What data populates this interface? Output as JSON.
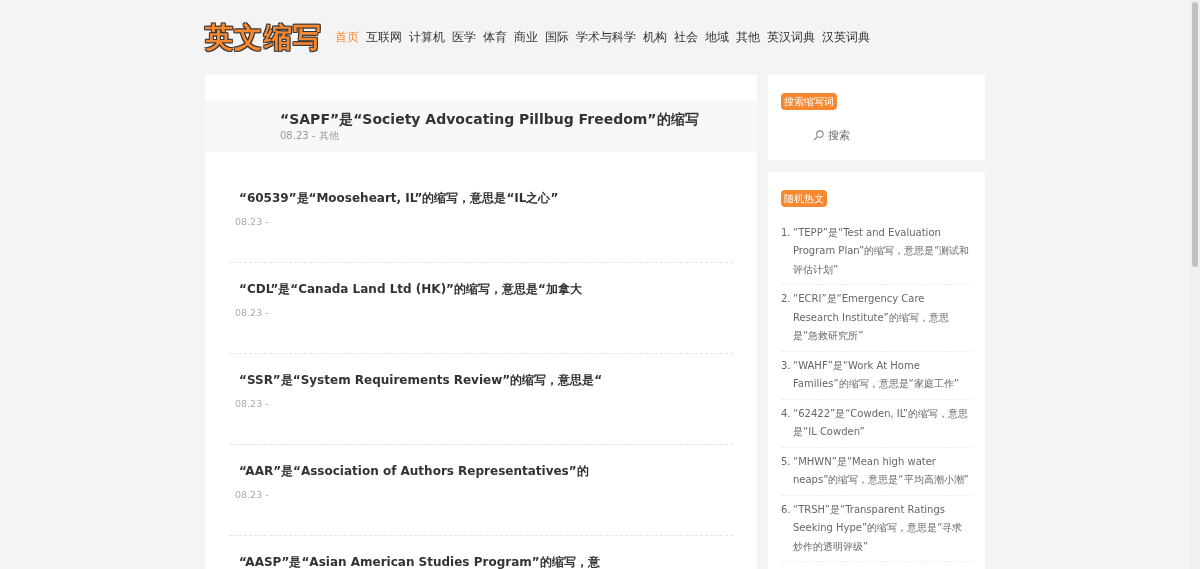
{
  "logo": "英文缩写",
  "nav": [
    {
      "label": "首页",
      "selected": true
    },
    {
      "label": "互联网",
      "selected": false
    },
    {
      "label": "计算机",
      "selected": false
    },
    {
      "label": "医学",
      "selected": false
    },
    {
      "label": "体育",
      "selected": false
    },
    {
      "label": "商业",
      "selected": false
    },
    {
      "label": "国际",
      "selected": false
    },
    {
      "label": "学术与科学",
      "selected": false
    },
    {
      "label": "机构",
      "selected": false
    },
    {
      "label": "社会",
      "selected": false
    },
    {
      "label": "地域",
      "selected": false
    },
    {
      "label": "其他",
      "selected": false
    },
    {
      "label": "英汉词典",
      "selected": false
    },
    {
      "label": "汉英词典",
      "selected": false
    }
  ],
  "featured": {
    "title": "“SAPF”是“Society Advocating Pillbug Freedom”的缩写",
    "meta": "08.23 - 其他"
  },
  "posts": [
    {
      "title": "“60539”是“Mooseheart, IL”的缩写，意思是“IL之心”",
      "meta": "08.23 -"
    },
    {
      "title": "“CDL”是“Canada Land Ltd (HK)”的缩写，意思是“加拿大",
      "meta": "08.23 -"
    },
    {
      "title": "“SSR”是“System Requirements Review”的缩写，意思是“",
      "meta": "08.23 -"
    },
    {
      "title": "“AAR”是“Association of Authors Representatives”的",
      "meta": "08.23 -"
    },
    {
      "title": "“AASP”是“Asian American Studies Program”的缩写，意"
    }
  ],
  "search_widget": {
    "title": "搜索缩写词",
    "placeholder": "搜索"
  },
  "random_widget": {
    "title": "随机热文",
    "items": [
      {
        "number": "1.",
        "text": "“TEPP”是“Test and Evaluation Program Plan”的缩写，意思是“测试和评估计划”"
      },
      {
        "number": "2.",
        "text": "“ECRI”是“Emergency Care Research Institute”的缩写，意思是“急救研究所”"
      },
      {
        "number": "3.",
        "text": "“WAHF”是“Work At Home Families”的缩写，意思是“家庭工作”"
      },
      {
        "number": "4.",
        "text": "“62422”是“Cowden, IL”的缩写，意思是“IL Cowden”"
      },
      {
        "number": "5.",
        "text": "“MHWN”是“Mean high water neaps”的缩写，意思是“平均高潮小潮”"
      },
      {
        "number": "6.",
        "text": "“TRSH”是“Transparent Ratings Seeking Hype”的缩写，意思是“寻求炒作的透明评级”"
      }
    ]
  }
}
